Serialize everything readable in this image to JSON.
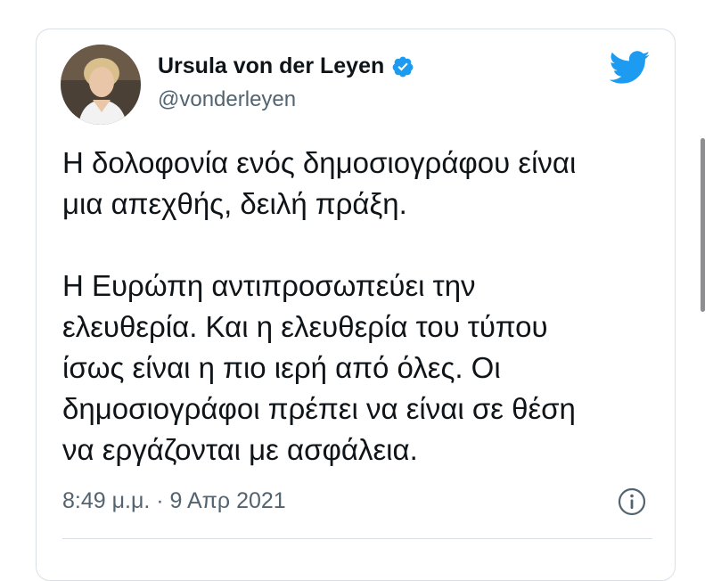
{
  "tweet": {
    "author": {
      "display_name": "Ursula von der Leyen",
      "handle": "@vonderleyen",
      "verified": true,
      "avatar_icon": "profile-photo"
    },
    "paragraphs": [
      [
        "Η δολοφονία ενός δημοσιογράφου είναι",
        "μια απεχθής, δειλή πράξη."
      ],
      [
        "Η Ευρώπη αντιπροσωπεύει την",
        "ελευθερία. Και η ελευθερία του τύπου",
        "ίσως είναι η πιο ιερή από όλες. Οι",
        "δημοσιογράφοι πρέπει να είναι σε θέση",
        "να εργάζονται με ασφάλεια."
      ]
    ],
    "timestamp": "8:49 μ.μ. · 9 Απρ 2021"
  },
  "icons": {
    "brand": "twitter-bird-icon",
    "verified": "verified-badge-icon",
    "info": "info-icon"
  },
  "colors": {
    "brand_blue": "#1d9bf0",
    "text": "#0f1419",
    "muted": "#536471",
    "border": "#d9dfe4"
  }
}
